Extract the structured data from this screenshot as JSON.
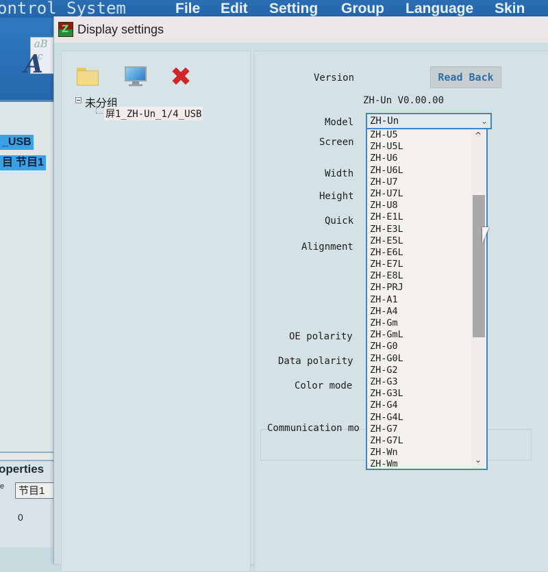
{
  "app": {
    "title_fragment": "ontrol System",
    "menu": [
      "File",
      "Edit",
      "Setting",
      "Group",
      "Language",
      "Skin"
    ],
    "tree_highlight_1": "_USB",
    "tree_highlight_2a": "目",
    "tree_highlight_2b": "节目1",
    "properties": {
      "title": "operties",
      "name_label_fragment": "e",
      "name_value": "节目1",
      "value_zero": "0"
    }
  },
  "dialog": {
    "title": "Display settings",
    "toolbar": {
      "icons": [
        "folder-icon",
        "monitor-icon",
        "delete-icon"
      ],
      "delete_glyph": "✖"
    },
    "tree": {
      "root_label": "未分组",
      "child_label": "屏1_ZH-Un_1/4_USB"
    },
    "form": {
      "version_label": "Version",
      "read_back_label": "Read Back",
      "version_value": "ZH-Un V0.00.00",
      "model_label": "Model",
      "model_value": "ZH-Un",
      "screen_label": "Screen",
      "width_label": "Width",
      "height_label": "Height",
      "quick_label": "Quick",
      "alignment_label": "Alignment",
      "oe_polarity_label": "OE polarity",
      "data_polarity_label": "Data polarity",
      "color_mode_label": "Color mode",
      "communication_label": "Communication mo"
    },
    "model_dropdown": {
      "options": [
        "ZH-U5",
        "ZH-U5L",
        "ZH-U6",
        "ZH-U6L",
        "ZH-U7",
        "ZH-U7L",
        "ZH-U8",
        "ZH-E1L",
        "ZH-E3L",
        "ZH-E5L",
        "ZH-E6L",
        "ZH-E7L",
        "ZH-E8L",
        "ZH-PRJ",
        "ZH-A1",
        "ZH-A4",
        "ZH-Gm",
        "ZH-GmL",
        "ZH-G0",
        "ZH-G0L",
        "ZH-G2",
        "ZH-G3",
        "ZH-G3L",
        "ZH-G4",
        "ZH-G4L",
        "ZH-G7",
        "ZH-G7L",
        "ZH-Wn",
        "ZH-Wm"
      ],
      "scroll_up": "^",
      "scroll_down": "⌄",
      "chevron": "⌄"
    }
  }
}
